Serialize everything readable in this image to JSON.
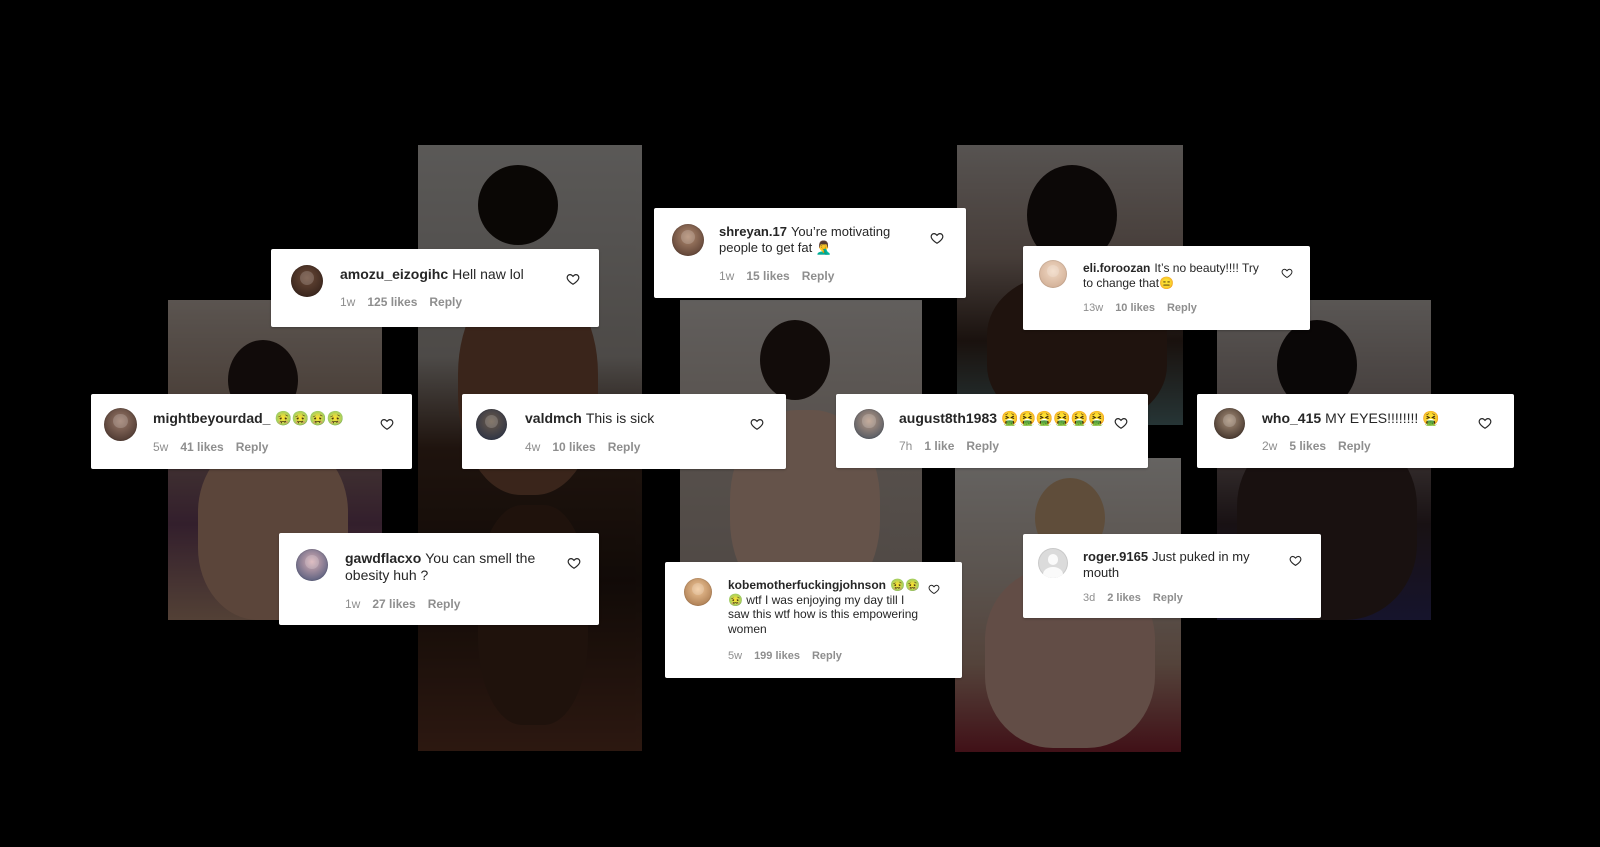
{
  "comments": [
    {
      "user": "amozu_eizogihc",
      "text": "Hell naw lol",
      "age": "1w",
      "likes": "125 likes",
      "reply": "Reply"
    },
    {
      "user": "shreyan.17",
      "text": "You’re motivating people to get fat 🤦‍♂️",
      "age": "1w",
      "likes": "15 likes",
      "reply": "Reply"
    },
    {
      "user": "eli.foroozan",
      "text": "It’s no beauty!!!! Try to change that😑",
      "age": "13w",
      "likes": "10 likes",
      "reply": "Reply"
    },
    {
      "user": "mightbeyourdad_",
      "text": "🤢🤢🤢🤢",
      "age": "5w",
      "likes": "41 likes",
      "reply": "Reply"
    },
    {
      "user": "valdmch",
      "text": "This is sick",
      "age": "4w",
      "likes": "10 likes",
      "reply": "Reply"
    },
    {
      "user": "august8th1983",
      "text": "🤮🤮🤮🤮🤮🤮",
      "age": "7h",
      "likes": "1 like",
      "reply": "Reply"
    },
    {
      "user": "who_415",
      "text": "MY EYES!!!!!!!! 🤮",
      "age": "2w",
      "likes": "5 likes",
      "reply": "Reply"
    },
    {
      "user": "gawdflacxo",
      "text": "You can smell the obesity huh ?",
      "age": "1w",
      "likes": "27 likes",
      "reply": "Reply"
    },
    {
      "user": "kobemotherfuckingjohnson",
      "text": "🤢🤢🤢 wtf I was enjoying my day till I saw this wtf how is this empowering women",
      "age": "5w",
      "likes": "199 likes",
      "reply": "Reply"
    },
    {
      "user": "roger.9165",
      "text": "Just puked in my mouth",
      "age": "3d",
      "likes": "2 likes",
      "reply": "Reply"
    }
  ],
  "icons": {
    "like": "heart-outline-icon",
    "avatar": "user-avatar-icon"
  },
  "colors": {
    "background": "#000000",
    "card": "#ffffff",
    "username": "#262626",
    "meta": "#8e8e8e"
  }
}
